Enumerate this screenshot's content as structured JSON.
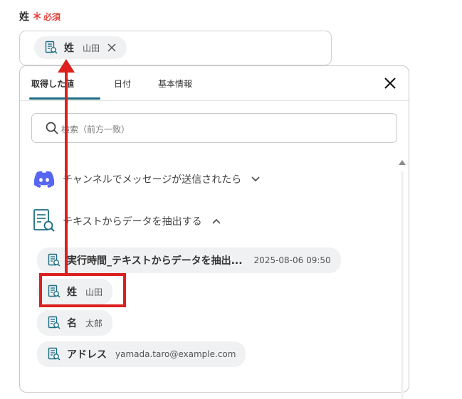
{
  "field": {
    "label": "姓",
    "required_mark": "＊",
    "required_text": "必須",
    "selected_token": {
      "name": "姓",
      "value": "山田",
      "remove_icon": "close-icon"
    }
  },
  "dropdown": {
    "tabs": [
      {
        "label": "取得した値",
        "active": true
      },
      {
        "label": "日付",
        "active": false
      },
      {
        "label": "基本情報",
        "active": false
      }
    ],
    "close_icon": "close-icon",
    "search": {
      "placeholder": "検索（前方一致）",
      "icon": "search-icon"
    },
    "sections": [
      {
        "label": "チャンネルでメッセージが送信されたら",
        "icon": "discord-icon",
        "expanded": false
      },
      {
        "label": "テキストからデータを抽出する",
        "icon": "document-search-icon",
        "expanded": true
      }
    ],
    "items": [
      {
        "name": "実行時間_テキストからデータを抽出...",
        "value": "2025-08-06 09:50"
      },
      {
        "name": "姓",
        "value": "山田"
      },
      {
        "name": "名",
        "value": "太郎"
      },
      {
        "name": "アドレス",
        "value": "yamada.taro@example.com"
      }
    ]
  },
  "annotation": {
    "color": "#dc1f1f"
  },
  "colors": {
    "required": "#e2463f",
    "tab_accent": "#1b6d82",
    "discord": "#5865f2",
    "pill_bg": "#f0f1f3"
  }
}
